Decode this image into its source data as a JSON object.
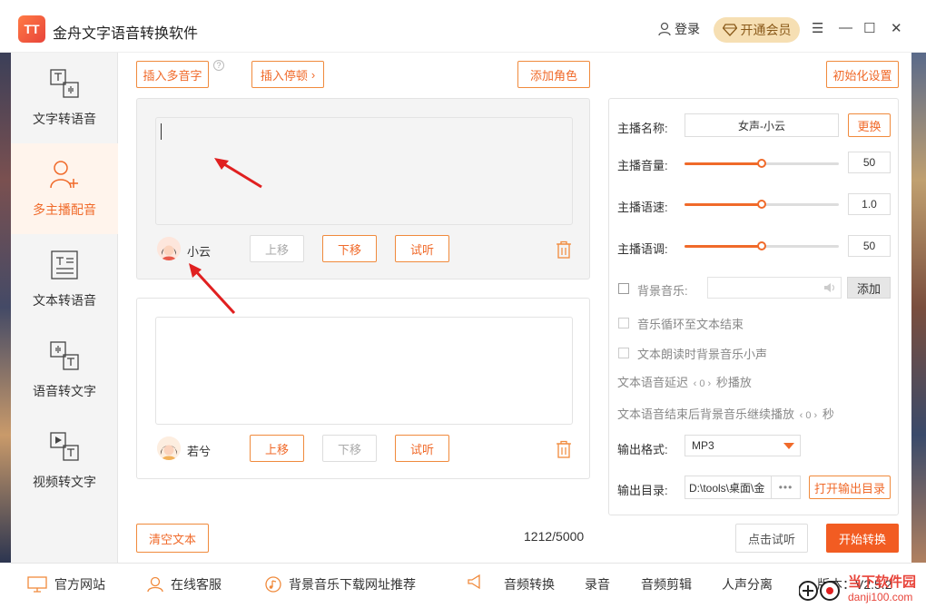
{
  "window": {
    "app_logo_text": "TT",
    "title": "金舟文字语音转换软件",
    "login_label": "登录",
    "vip_label": "开通会员",
    "controls": [
      "☰",
      "—",
      "☐",
      "✕"
    ]
  },
  "sidebar": {
    "items": [
      {
        "label": "文字转语音",
        "icon": "text-to-speech-icon"
      },
      {
        "label": "多主播配音",
        "icon": "add-user-icon"
      },
      {
        "label": "文本转语音",
        "icon": "document-icon"
      },
      {
        "label": "语音转文字",
        "icon": "speech-to-text-icon"
      },
      {
        "label": "视频转文字",
        "icon": "video-to-text-icon"
      }
    ],
    "active_index": 1
  },
  "toolbar": {
    "insert_polyphone": "插入多音字",
    "help_glyph": "?",
    "insert_pause": "插入停顿",
    "pause_chevron": "›",
    "add_role": "添加角色",
    "init_settings": "初始化设置"
  },
  "speakers": [
    {
      "name": "小云",
      "move_up": "上移",
      "move_down": "下移",
      "listen": "试听",
      "up_enabled": false,
      "down_enabled": true,
      "text": ""
    },
    {
      "name": "若兮",
      "move_up": "上移",
      "move_down": "下移",
      "listen": "试听",
      "up_enabled": true,
      "down_enabled": false,
      "text": ""
    }
  ],
  "settings": {
    "anchor_name_label": "主播名称:",
    "anchor_name_value": "女声-小云",
    "change_button": "更换",
    "volume_label": "主播音量:",
    "volume_value": "50",
    "volume_fraction": 0.5,
    "speed_label": "主播语速:",
    "speed_value": "1.0",
    "speed_fraction": 0.5,
    "pitch_label": "主播语调:",
    "pitch_value": "50",
    "pitch_fraction": 0.5,
    "bgm_label": "背景音乐:",
    "bgm_add": "添加",
    "loop_label": "音乐循环至文本结束",
    "duck_label": "文本朗读时背景音乐小声",
    "delay_prefix": "文本语音延迟",
    "delay_value": "0",
    "delay_suffix": "秒播放",
    "continue_prefix": "文本语音结束后背景音乐继续播放",
    "continue_value": "0",
    "continue_suffix": "秒",
    "format_label": "输出格式:",
    "format_value": "MP3",
    "dir_label": "输出目录:",
    "dir_value": "D:\\tools\\桌面\\金",
    "dir_more": "•••",
    "open_dir": "打开输出目录"
  },
  "bottom": {
    "clear_text": "清空文本",
    "char_count": "1212/5000",
    "listen_all": "点击试听",
    "start": "开始转换"
  },
  "footer": {
    "website": "官方网站",
    "support": "在线客服",
    "bgm_sites": "背景音乐下载网址推荐",
    "audio_convert": "音频转换",
    "record": "录音",
    "audio_edit": "音频剪辑",
    "vocal_split": "人声分离",
    "version": "版本：V2.5.2"
  },
  "watermark": {
    "line1": "当下软件园",
    "line2": "danji100.com"
  },
  "colors": {
    "accent": "#f06a2a",
    "vip_bg": "#f6dfb3",
    "start_bg": "#f25c22",
    "annotation_arrow": "#e02020"
  }
}
